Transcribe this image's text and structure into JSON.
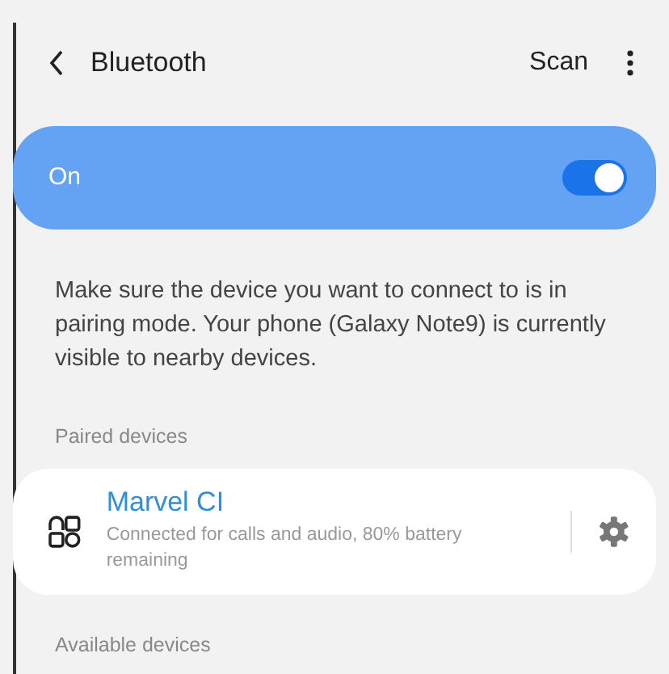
{
  "header": {
    "title": "Bluetooth",
    "action": "Scan"
  },
  "master_switch": {
    "label": "On",
    "on": true
  },
  "description": "Make sure the device you want to connect to is in pairing mode. Your phone (Galaxy Note9) is currently visible to nearby devices.",
  "paired_devices": {
    "heading": "Paired devices",
    "devices": [
      {
        "name": "Marvel CI",
        "status": "Connected for calls and audio, 80% battery remaining",
        "connected": true
      }
    ]
  },
  "available_devices": {
    "heading": "Available devices"
  }
}
